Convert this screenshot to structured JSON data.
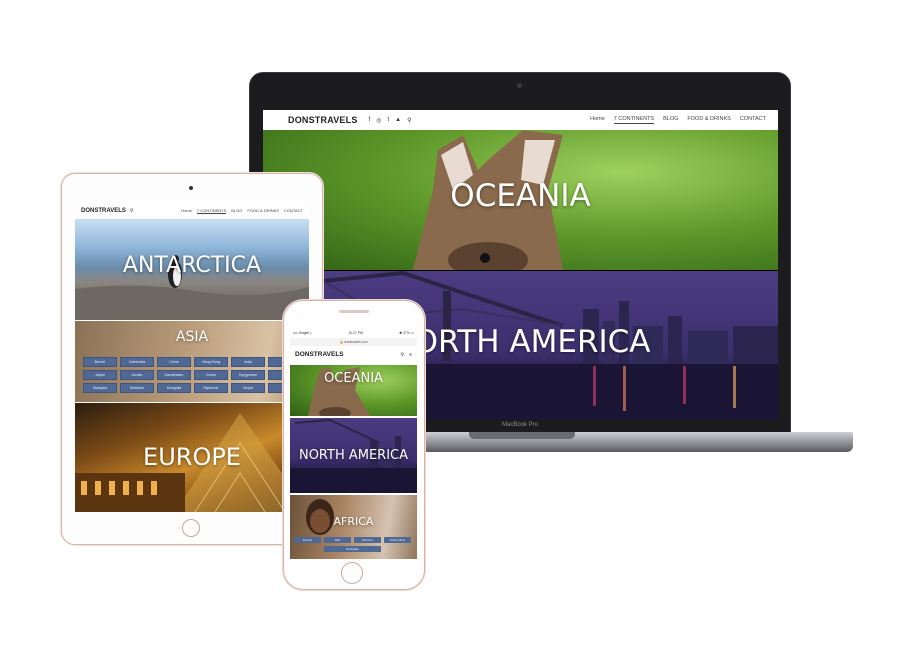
{
  "laptop": {
    "brand_label": "MacBook Pro",
    "site": {
      "logo": "DONSTRAVELS",
      "social_icons": [
        "facebook-icon",
        "instagram-icon",
        "twitter-icon",
        "snapchat-icon",
        "search-icon"
      ],
      "social_glyphs": [
        "f",
        "◎",
        "t",
        "▲",
        "⚲"
      ],
      "nav": [
        "Home",
        "7 CONTINENTS",
        "BLOG",
        "FOOD & DRINKS",
        "CONTACT"
      ],
      "sections": [
        "OCEANIA",
        "NORTH AMERICA"
      ]
    }
  },
  "tablet": {
    "site": {
      "logo": "DONSTRAVELS",
      "search_glyph": "⚲",
      "nav": [
        "Home",
        "7 CONTINENTS",
        "BLOG",
        "FOOD & DRINKS",
        "CONTACT"
      ],
      "sections": [
        "ANTARCTICA",
        "ASIA",
        "EUROPE"
      ],
      "asia_countries": [
        "Brunei",
        "Cambodia",
        "China",
        "Hong Kong",
        "India",
        "Ind",
        "Japan",
        "Jordan",
        "Kazakhstan",
        "Korea",
        "Kyrgyzstan",
        "M",
        "Malaysia",
        "Maldives",
        "Mongolia",
        "Myanmar",
        "Nepal",
        "Phi"
      ]
    }
  },
  "phone": {
    "status": {
      "carrier": "•••• Singtel ≈",
      "time": "10:27 PM",
      "battery": "✱ 37% ▭"
    },
    "url": "🔒 donstravels.com",
    "site": {
      "logo": "DONSTRAVELS",
      "search_glyph": "⚲",
      "menu_glyph": "≡",
      "sections": [
        "OCEANIA",
        "NORTH AMERICA",
        "AFRICA"
      ],
      "africa_countries": [
        "Zambia",
        "Mali",
        "Morocco",
        "South Africa",
        "Zimbabwe"
      ]
    }
  }
}
